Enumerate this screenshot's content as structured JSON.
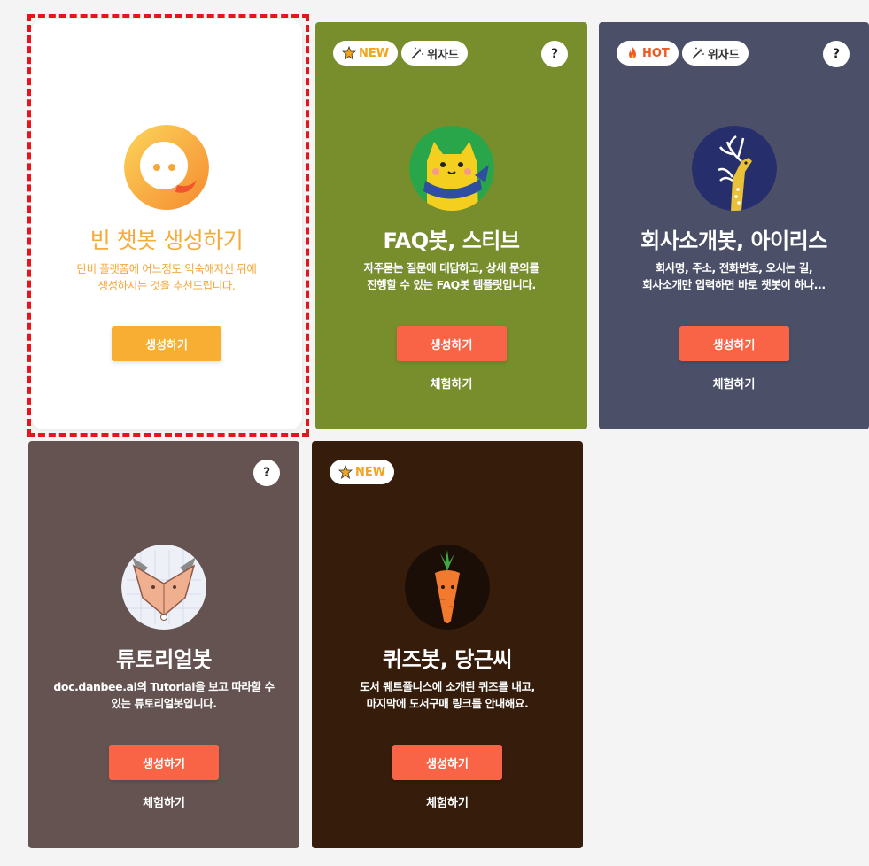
{
  "cards": [
    {
      "title": "빈 챗봇 생성하기",
      "desc": [
        "단비 플랫폼에 어느정도 익숙해지신 뒤에",
        "생성하시는 것을 추천드립니다."
      ],
      "create_label": "생성하기",
      "bg": "#ffffff",
      "accent": "#f7ae33",
      "icon": "chat-bubble-icon",
      "selected": true
    },
    {
      "title": "FAQ봇, 스티브",
      "desc": [
        "자주묻는 질문에 대답하고, 상세 문의를",
        "진행할 수 있는 FAQ봇 템플릿입니다."
      ],
      "create_label": "생성하기",
      "try_label": "체험하기",
      "bg": "#788d2c",
      "badges": [
        {
          "icon": "star-icon",
          "label": "NEW"
        },
        {
          "icon": "magic-wand-icon",
          "label": "위자드"
        }
      ],
      "help": "?",
      "icon": "cat-mascot-icon"
    },
    {
      "title": "회사소개봇, 아이리스",
      "desc": [
        "회사명, 주소, 전화번호, 오시는 길,",
        "회사소개만 입력하면 바로 챗봇이 하나..."
      ],
      "create_label": "생성하기",
      "try_label": "체험하기",
      "bg": "#4b5068",
      "badges": [
        {
          "icon": "fire-icon",
          "label": "HOT"
        },
        {
          "icon": "magic-wand-icon",
          "label": "위자드"
        }
      ],
      "help": "?",
      "icon": "deer-mascot-icon"
    },
    {
      "title": "튜토리얼봇",
      "desc": [
        "doc.danbee.ai의 Tutorial을 보고 따라할 수",
        "있는 튜토리얼봇입니다."
      ],
      "create_label": "생성하기",
      "try_label": "체험하기",
      "bg": "#645351",
      "help": "?",
      "icon": "fox-mascot-icon"
    },
    {
      "title": "퀴즈봇, 당근씨",
      "desc": [
        "도서 퀘트풀니스에 소개된 퀴즈를 내고,",
        "마지막에 도서구매 링크를 안내해요."
      ],
      "create_label": "생성하기",
      "try_label": "체험하기",
      "bg": "#351c0b",
      "badges": [
        {
          "icon": "star-icon",
          "label": "NEW"
        }
      ],
      "icon": "carrot-mascot-icon"
    }
  ],
  "colors": {
    "button": "#fa6446",
    "new_badge": "#f1a51c",
    "hot_badge": "#f05a22",
    "selection_dash": "#e8141b"
  }
}
